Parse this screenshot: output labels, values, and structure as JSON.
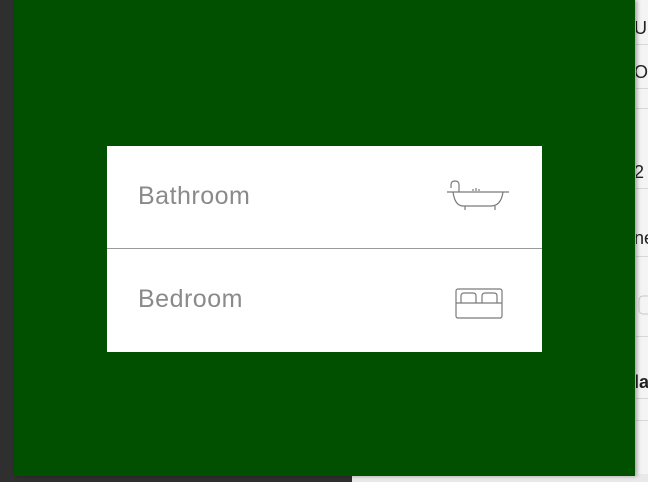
{
  "room_menu": {
    "items": [
      {
        "label": "Bathroom",
        "icon": "bathtub-icon"
      },
      {
        "label": "Bedroom",
        "icon": "bed-icon"
      }
    ]
  },
  "background_panel": {
    "fragments": [
      "U",
      "O",
      "2",
      "ne",
      "la"
    ]
  },
  "colors": {
    "overlay": "#005000",
    "menu_background": "#ffffff",
    "label_text": "#8a8a8a",
    "divider": "#9a9a9a"
  }
}
